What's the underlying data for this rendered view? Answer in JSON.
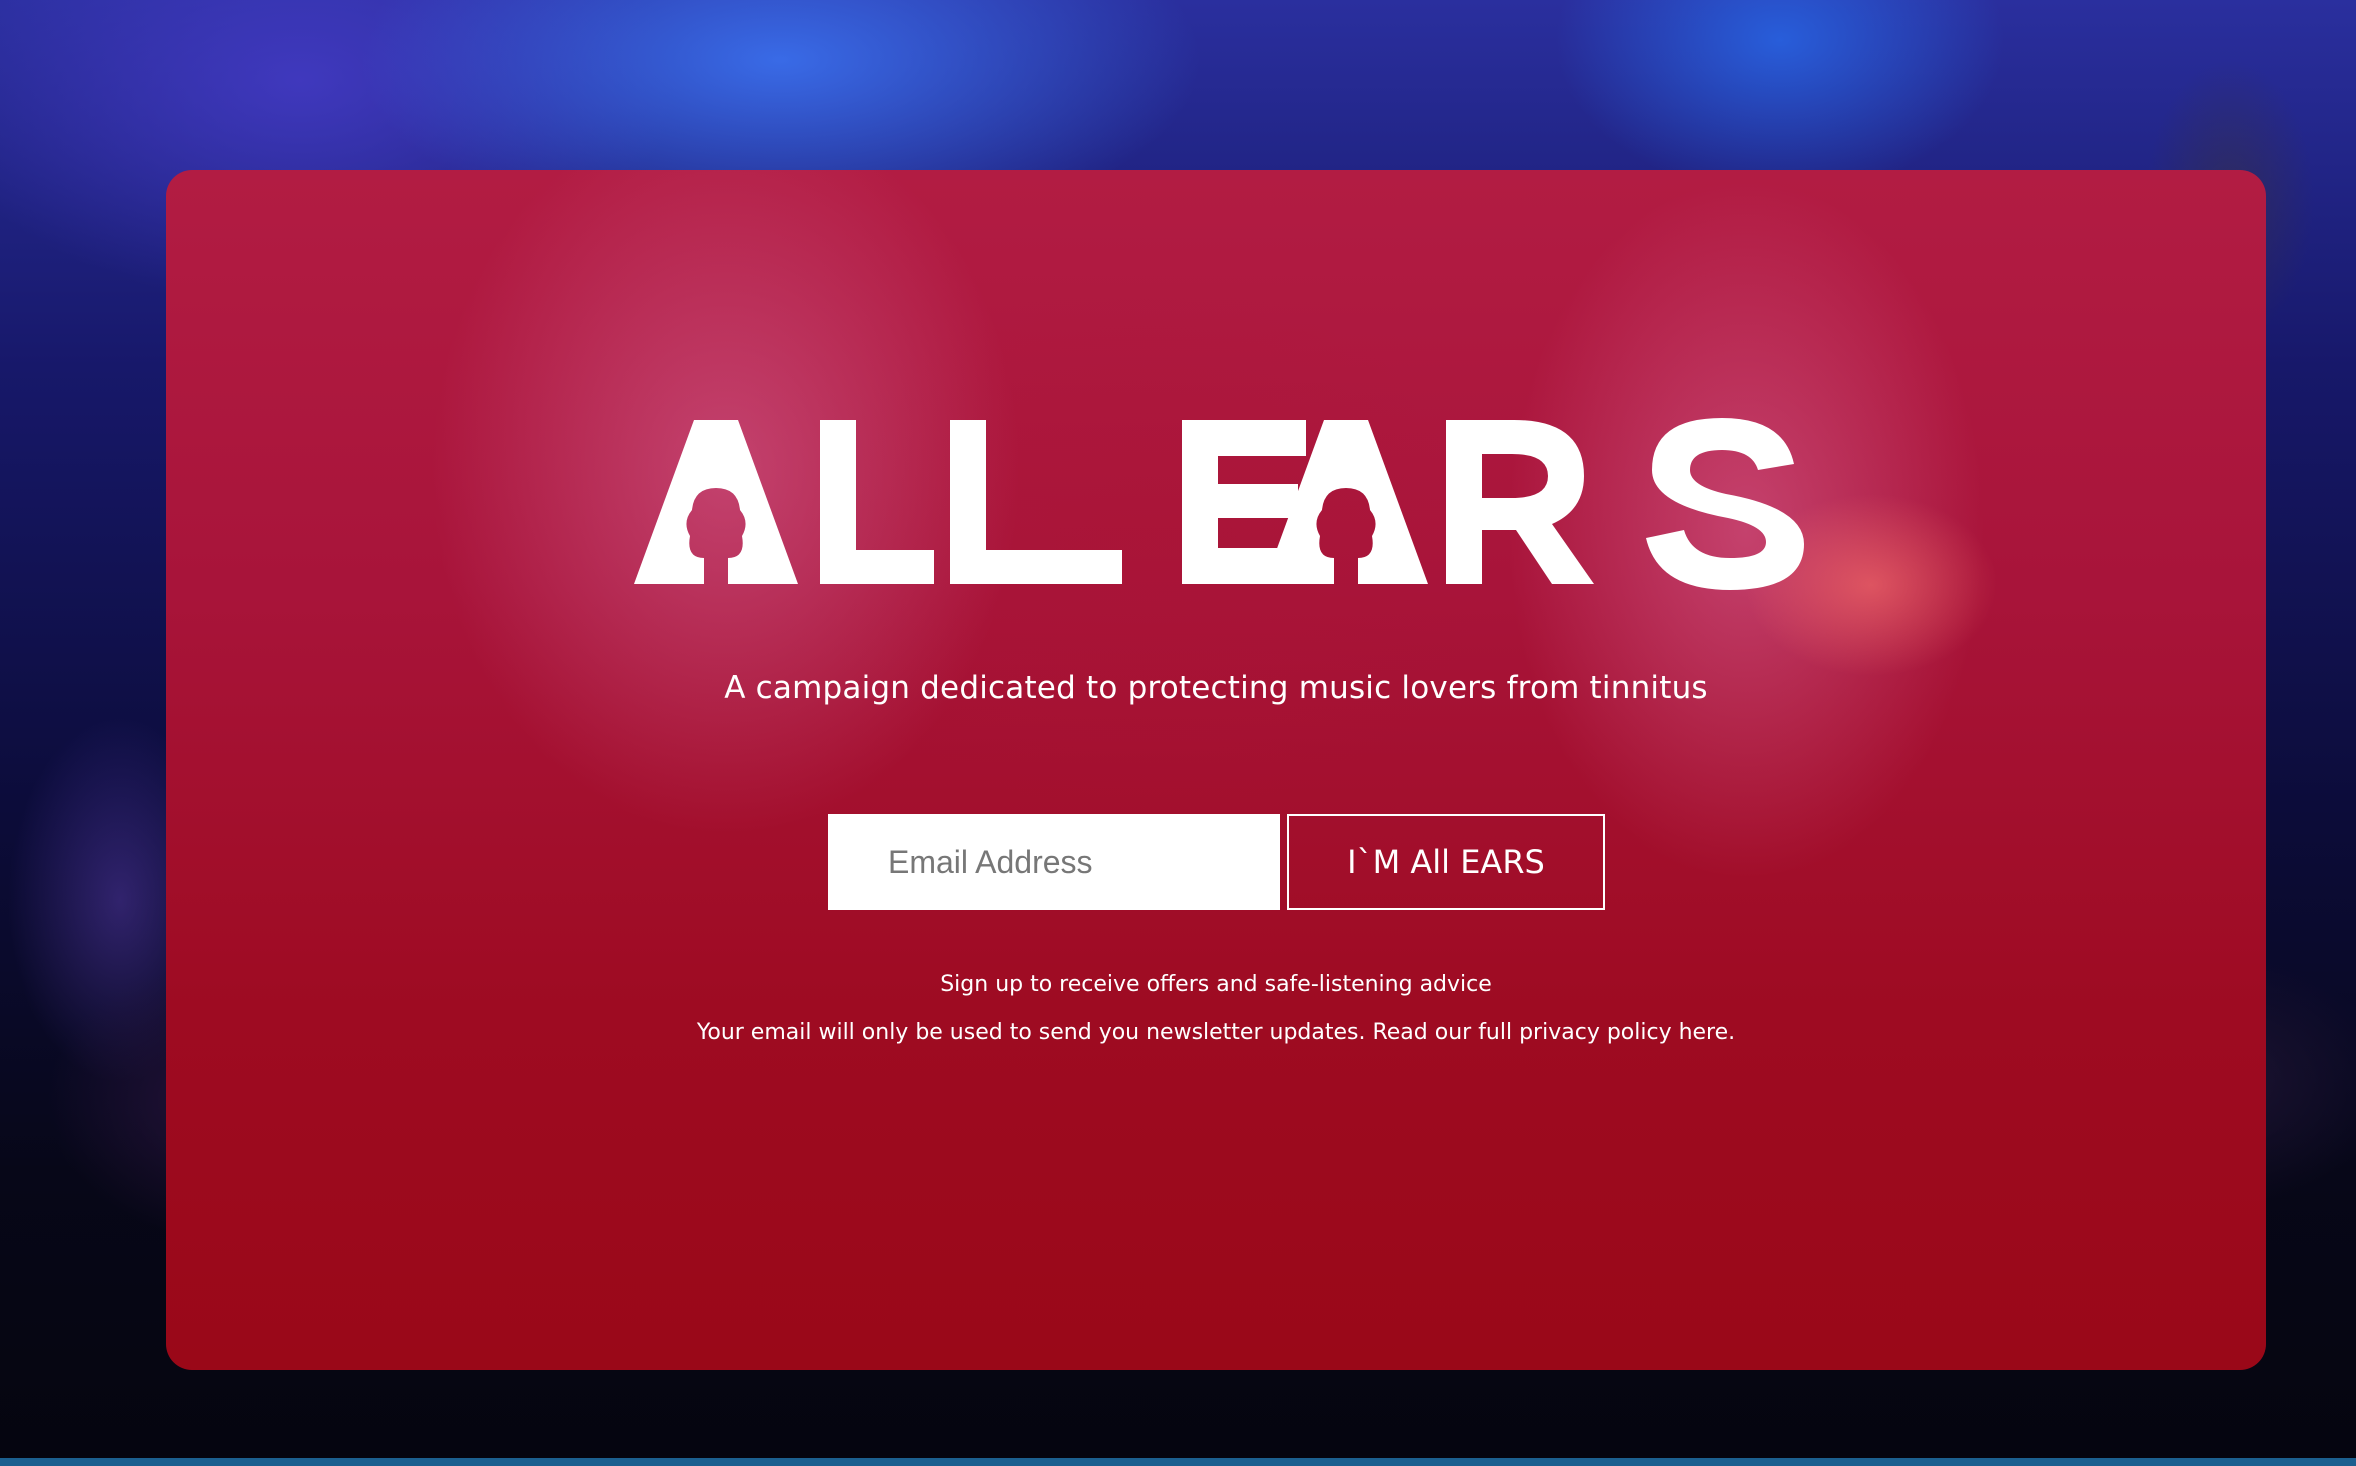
{
  "hero": {
    "logo_text": "ALL EARS",
    "tagline": "A campaign dedicated to protecting music lovers from tinnitus"
  },
  "signup": {
    "email_placeholder": "Email Address",
    "submit_label": "I`M All EARS",
    "note": "Sign up to receive offers and safe-listening advice",
    "privacy_text": "Your email will only be used to send you newsletter updates. Read our full privacy policy here."
  },
  "colors": {
    "panel": "#a8143a",
    "text": "#ffffff",
    "input_background": "#ffffff"
  }
}
